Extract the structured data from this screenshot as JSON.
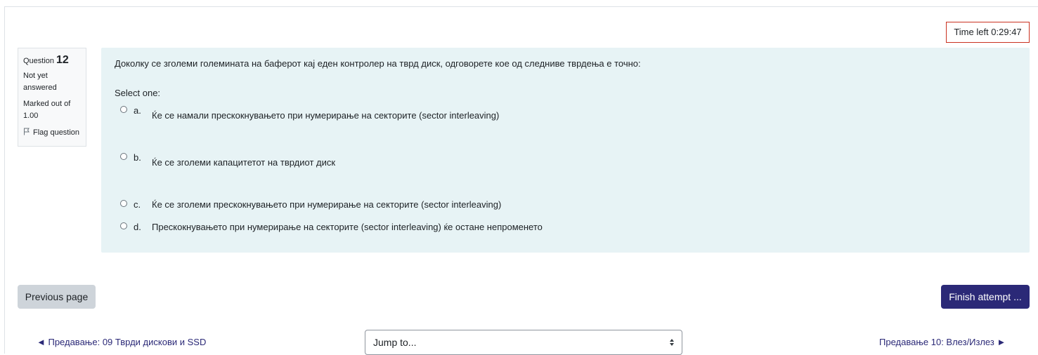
{
  "timer": {
    "text": "Time left 0:29:47"
  },
  "question_info": {
    "label": "Question",
    "number": "12",
    "state_line1": "Not yet",
    "state_line2": "answered",
    "grade_line1": "Marked out of",
    "grade_line2": "1.00",
    "flag_label": "Flag question"
  },
  "question": {
    "text": "Доколку се зголеми големината на баферот кај еден контролер на тврд диск, одговорете кое од следниве тврдења е точно:",
    "prompt": "Select one:",
    "options": [
      {
        "letter": "a.",
        "text": "Ќе се намали прескокнувањето при нумерирање на секторите (sector interleaving)"
      },
      {
        "letter": "b.",
        "text": "Ќе се зголеми капацитетот на тврдиот диск"
      },
      {
        "letter": "c.",
        "text": "Ќе се зголеми прескокнувањето при нумерирање на секторите (sector interleaving)"
      },
      {
        "letter": "d.",
        "text": "Прескокнувањето при нумерирање на секторите (sector interleaving) ќе остане непроменето"
      }
    ]
  },
  "navigation": {
    "previous_page": "Previous page",
    "finish_attempt": "Finish attempt ...",
    "prev_activity": "◄ Предавање: 09 Тврди дискови и SSD",
    "next_activity": "Предавање 10: Влез/Излез ►",
    "jump_to": "Jump to..."
  },
  "colors": {
    "accent": "#2b2977",
    "question_bg": "#e7f3f5",
    "timer_border": "#ca3120"
  }
}
